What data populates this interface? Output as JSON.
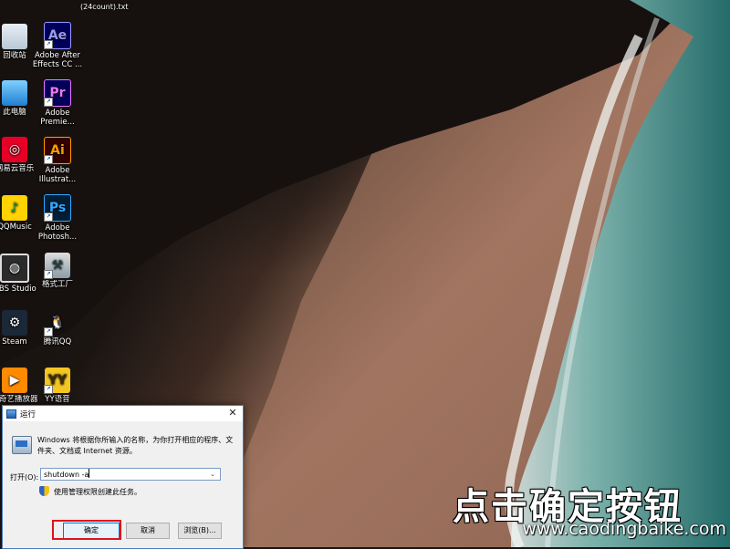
{
  "desktop": {
    "top_fragments": [
      "(24count).txt"
    ],
    "icons_col1": [
      {
        "label": "回收站",
        "icon": "recycle-bin-icon",
        "glyph": ""
      },
      {
        "label": "此电脑",
        "icon": "computer-icon",
        "glyph": ""
      },
      {
        "label": "网易云音乐",
        "icon": "netease-music-icon",
        "glyph": "◎"
      },
      {
        "label": "QQMusic",
        "icon": "qqmusic-icon",
        "glyph": "♪"
      },
      {
        "label": "OBS Studio",
        "icon": "obs-icon",
        "glyph": "◍"
      },
      {
        "label": "Steam",
        "icon": "steam-icon",
        "glyph": "⚙"
      },
      {
        "label": "爱奇艺播放器",
        "icon": "player-icon",
        "glyph": "▶"
      }
    ],
    "icons_col2": [
      {
        "label": "Adobe After Effects CC ...",
        "icon": "adobe-after-effects-icon",
        "glyph": "Ae"
      },
      {
        "label": "Adobe Premie...",
        "icon": "adobe-premiere-icon",
        "glyph": "Pr"
      },
      {
        "label": "Adobe Illustrat...",
        "icon": "adobe-illustrator-icon",
        "glyph": "Ai"
      },
      {
        "label": "Adobe Photosh...",
        "icon": "adobe-photoshop-icon",
        "glyph": "Ps"
      },
      {
        "label": "格式工厂",
        "icon": "format-factory-icon",
        "glyph": "⚒"
      },
      {
        "label": "腾讯QQ",
        "icon": "qq-penguin-icon",
        "glyph": "🐧"
      },
      {
        "label": "YY语音",
        "icon": "yy-voice-icon",
        "glyph": "YY"
      }
    ]
  },
  "run_dialog": {
    "title": "运行",
    "close": "✕",
    "description": "Windows 将根据你所输入的名称，为你打开相应的程序、文件夹、文档或 Internet 资源。",
    "open_label": "打开(O):",
    "open_value": "shutdown -a",
    "dropdown": "⌄",
    "admin_note": "使用管理权限创建此任务。",
    "ok": "确定",
    "cancel": "取消",
    "browse": "浏览(B)..."
  },
  "overlay": {
    "caption": "点击确定按钮",
    "watermark_url": "www.caodingbaike.com"
  },
  "colors": {
    "highlight": "#e0121c",
    "ok_border": "#0078d7"
  }
}
